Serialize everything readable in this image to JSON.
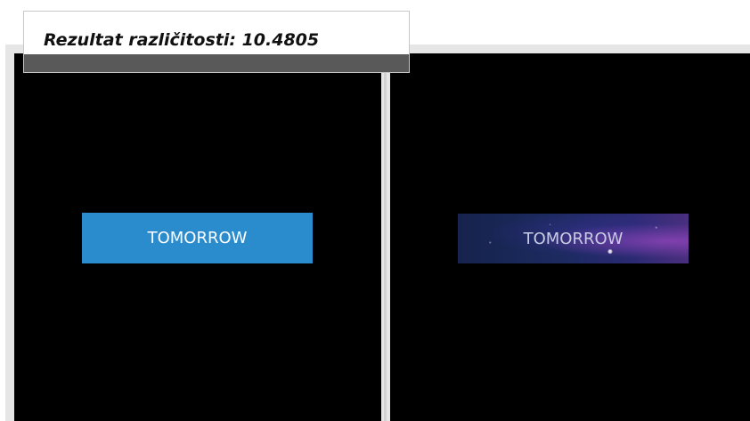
{
  "score": {
    "label": "Rezultat različitosti: 10.4805"
  },
  "left_panel": {
    "button_label": "TOMORROW",
    "button_color": "#2a8bcd",
    "background": "#000000"
  },
  "right_panel": {
    "button_label": "TOMORROW",
    "button_style": "starry-galaxy-gradient",
    "background": "#000000"
  }
}
